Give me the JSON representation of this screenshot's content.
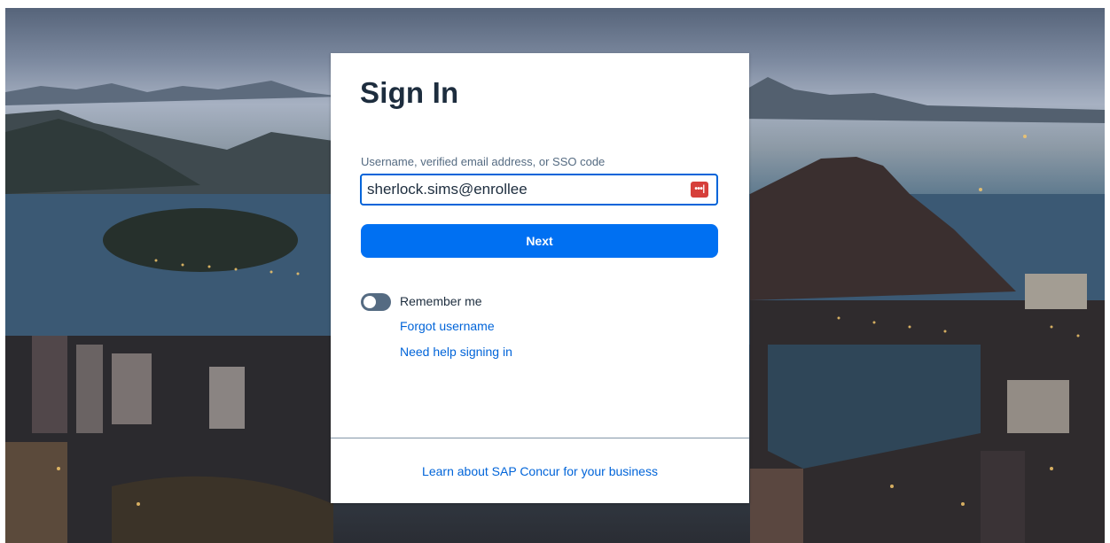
{
  "signin": {
    "title": "Sign In",
    "field_label": "Username, verified email address, or SSO code",
    "username_value": "sherlock.sims@enrollee",
    "password_manager_icon": "password-manager-icon",
    "password_manager_glyph": "•••|",
    "next_label": "Next",
    "remember_label": "Remember me",
    "remember_checked": false,
    "forgot_username_label": "Forgot username",
    "need_help_label": "Need help signing in",
    "footer_link_label": "Learn about SAP Concur for your business"
  },
  "colors": {
    "primary": "#0070f2",
    "link": "#0064d9",
    "title": "#1d2d3e",
    "toggle_off": "#556b82",
    "password_manager": "#d63f3a"
  }
}
